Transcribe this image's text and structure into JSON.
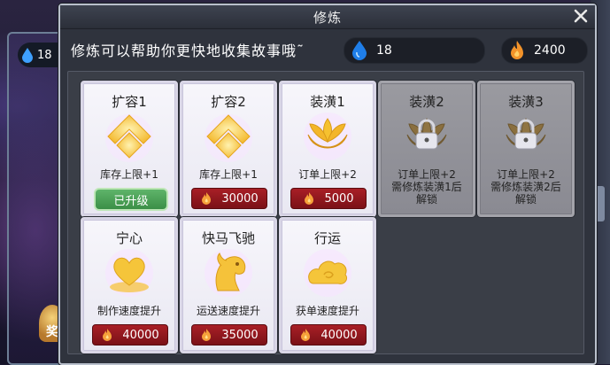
{
  "window": {
    "title": "修炼"
  },
  "header": {
    "description": "修炼可以帮助你更快地收集故事哦˜"
  },
  "resources": {
    "water": "18",
    "fire": "2400"
  },
  "background": {
    "left_res": "18",
    "reward_label": "奖"
  },
  "cards": [
    {
      "name": "扩容1",
      "effect": "库存上限+1",
      "status": "已升级",
      "icon": "chevron-up-icon"
    },
    {
      "name": "扩容2",
      "effect": "库存上限+1",
      "cost": "30000",
      "icon": "chevron-up-icon"
    },
    {
      "name": "装潢1",
      "effect": "订单上限+2",
      "cost": "5000",
      "icon": "lotus-icon"
    },
    {
      "name": "装潢2",
      "effect": "订单上限+2",
      "lock_line1": "需修炼装潢1后",
      "lock_line2": "解锁",
      "icon": "locked-lotus-icon"
    },
    {
      "name": "装潢3",
      "effect": "订单上限+2",
      "lock_line1": "需修炼装潢2后",
      "lock_line2": "解锁",
      "icon": "locked-lotus-icon"
    },
    {
      "name": "宁心",
      "effect": "制作速度提升",
      "cost": "40000",
      "icon": "heart-icon"
    },
    {
      "name": "快马飞驰",
      "effect": "运送速度提升",
      "cost": "35000",
      "icon": "horse-icon"
    },
    {
      "name": "行运",
      "effect": "获单速度提升",
      "cost": "40000",
      "icon": "cloud-icon"
    }
  ],
  "colors": {
    "accent_gold": "#f5c542",
    "cost_red": "#a81f26",
    "upgraded_green": "#4ea35a"
  }
}
